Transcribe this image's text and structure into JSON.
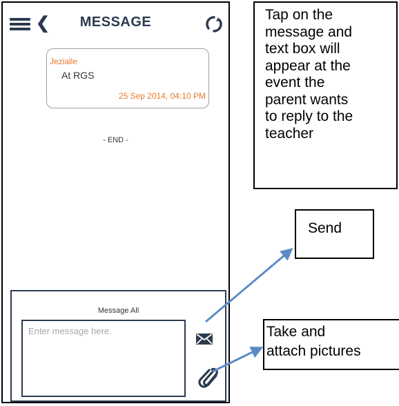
{
  "header": {
    "title": "MESSAGE",
    "menu_icon": "hamburger-menu-icon",
    "back_icon": "chevron-left-icon",
    "refresh_icon": "refresh-icon"
  },
  "message": {
    "sender": "Jezialle",
    "text": "At RGS",
    "timestamp": "25 Sep 2014, 04:10 PM"
  },
  "end_label": "- END -",
  "compose": {
    "title": "Message All",
    "placeholder": "Enter message here.",
    "send_icon": "envelope-icon",
    "attach_icon": "paperclip-icon"
  },
  "annotations": {
    "reply_note": [
      "Tap on the",
      "message and",
      "text box will",
      "appear at the",
      "event the",
      "parent wants",
      "to reply to the",
      "teacher"
    ],
    "send_label": "Send",
    "attach_label": [
      "Take and",
      "attach pictures"
    ]
  },
  "colors": {
    "header_text": "#2c3b4f",
    "accent_orange": "#e8782a",
    "arrow_blue": "#5b8bc6"
  }
}
